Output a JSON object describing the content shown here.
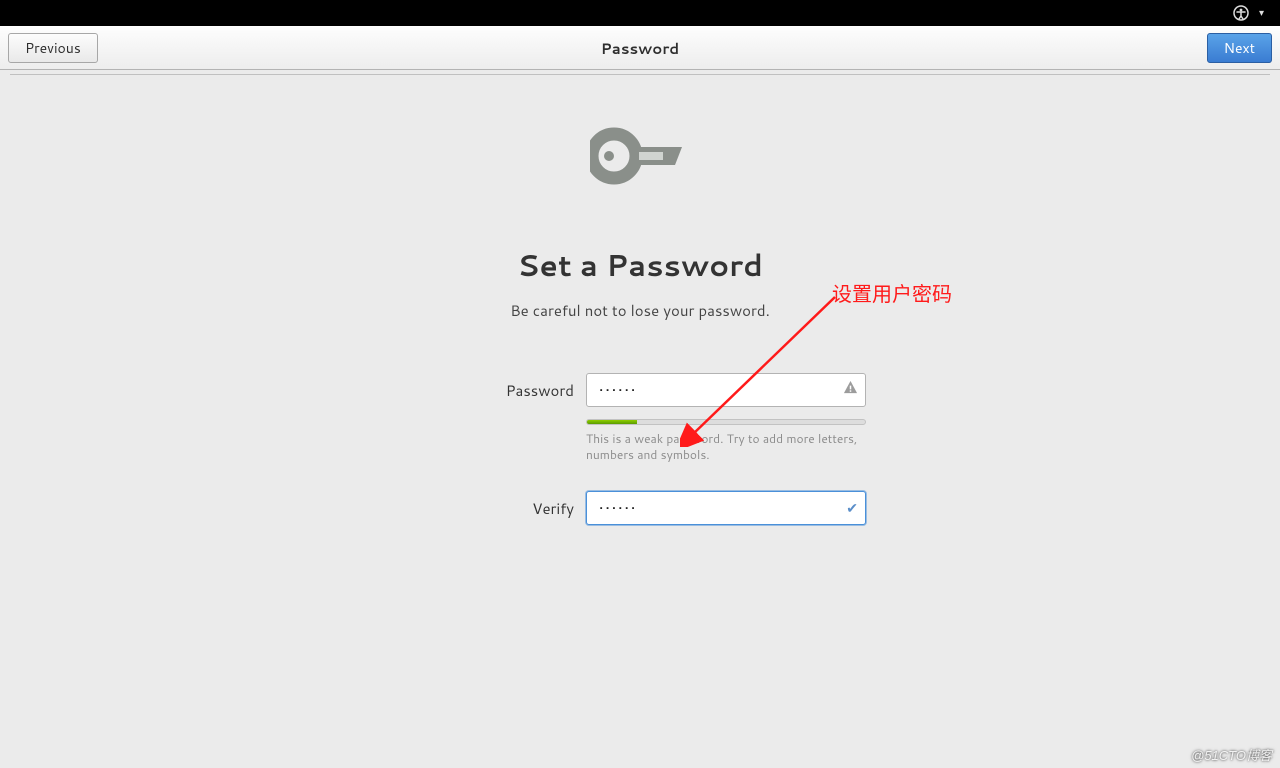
{
  "topbar": {
    "icons": {
      "accessibility": "accessibility-icon",
      "dropdown": "chevron-down-icon"
    }
  },
  "header": {
    "previous_label": "Previous",
    "title": "Password",
    "next_label": "Next"
  },
  "page": {
    "title": "Set a Password",
    "subtitle": "Be careful not to lose your password."
  },
  "fields": {
    "password": {
      "label": "Password",
      "value": "••••••",
      "strength_hint": "This is a weak password. Try to add more letters, numbers and symbols.",
      "warning_icon": "warning-icon"
    },
    "verify": {
      "label": "Verify",
      "value": "••••••",
      "check_icon": "check-icon"
    }
  },
  "annotation": {
    "text": "设置用户密码"
  },
  "watermark": "@51CTO博客"
}
